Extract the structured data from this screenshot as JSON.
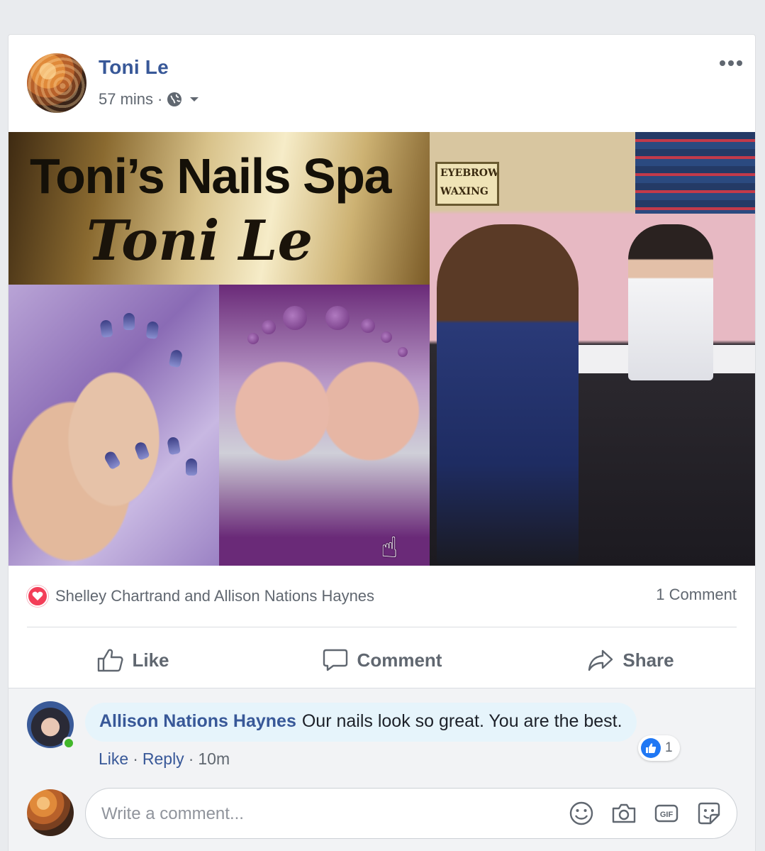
{
  "post": {
    "author": "Toni Le",
    "time": "57 mins",
    "separator": "·",
    "privacy_icon": "globe-icon",
    "more_icon": "more-options-icon"
  },
  "photo": {
    "banner_title": "Toni’s Nails Spa",
    "banner_subtitle": "Toni Le",
    "sign_line1": "EYEBROW",
    "sign_line2": "WAXING"
  },
  "reactions": {
    "icon": "love-reaction-icon",
    "names": "Shelley Chartrand and Allison Nations Haynes",
    "comment_count": "1 Comment",
    "love_color": "#f33e58"
  },
  "actions": {
    "like": "Like",
    "comment": "Comment",
    "share": "Share"
  },
  "comment": {
    "author": "Allison Nations Haynes",
    "text": "Our nails look so great. You are the best.",
    "like_label": "Like",
    "reply_label": "Reply",
    "age": "10m",
    "separator": "·",
    "like_count": "1"
  },
  "composer": {
    "placeholder": "Write a comment..."
  },
  "colors": {
    "link": "#385898",
    "secondary_text": "#606770",
    "like_blue": "#2078f4",
    "online": "#42b72a"
  }
}
